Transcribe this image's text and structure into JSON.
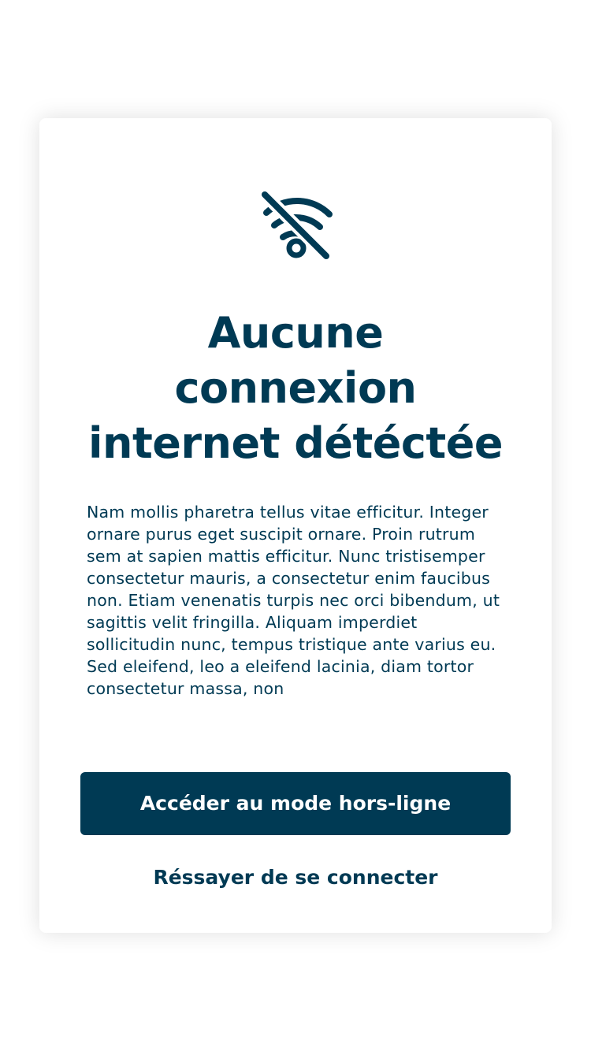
{
  "colors": {
    "primary": "#003a54",
    "background": "#ffffff",
    "button_text": "#ffffff"
  },
  "dialog": {
    "icon": "wifi-off-icon",
    "title": "Aucune\nconnexion\ninternet détéctée",
    "message": "Nam mollis pharetra tellus vitae efficitur. Integer ornare purus eget suscipit ornare. Proin rutrum sem at sapien mattis efficitur. Nunc tristisemper consectetur mauris, a consectetur enim faucibus non. Etiam venenatis turpis nec orci bibendum, ut sagittis velit fringilla. Aliquam imperdiet sollicitudin nunc, tempus tristique ante varius eu. Sed eleifend, leo a eleifend lacinia, diam tortor consectetur massa, non",
    "primary_button_label": "Accéder au mode hors-ligne",
    "secondary_link_label": "Réssayer de se connecter"
  }
}
